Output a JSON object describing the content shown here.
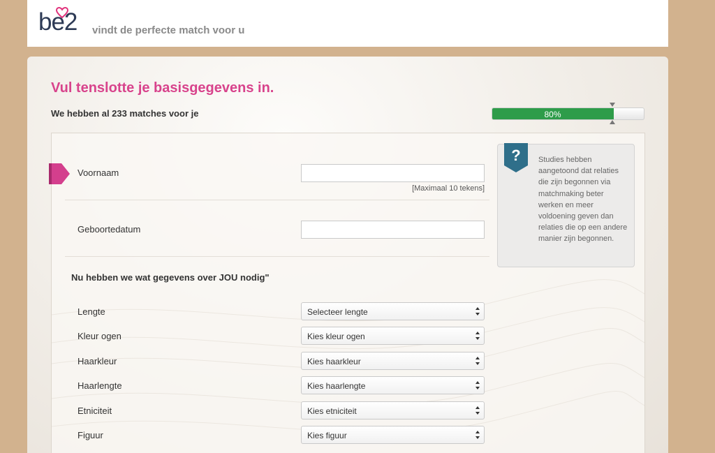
{
  "header": {
    "logo_text": "be2",
    "tagline": "vindt de perfecte match voor u"
  },
  "page": {
    "title": "Vul tenslotte je basisgegevens in.",
    "subtitle": "We hebben al 233 matches voor je"
  },
  "progress": {
    "value": 0.8,
    "label": "80%"
  },
  "form": {
    "first_name": {
      "label": "Voornaam",
      "value": "",
      "hint": "[Maximaal 10 tekens]"
    },
    "birthdate": {
      "label": "Geboortedatum",
      "value": ""
    },
    "section_heading": "Nu hebben we wat gegevens over JOU nodig\"",
    "selects": [
      {
        "label": "Lengte",
        "value": "Selecteer lengte"
      },
      {
        "label": "Kleur ogen",
        "value": "Kies kleur ogen"
      },
      {
        "label": "Haarkleur",
        "value": "Kies haarkleur"
      },
      {
        "label": "Haarlengte",
        "value": "Kies haarlengte"
      },
      {
        "label": "Etniciteit",
        "value": "Kies etniciteit"
      },
      {
        "label": "Figuur",
        "value": "Kies figuur"
      }
    ]
  },
  "info": {
    "icon": "question-mark-icon",
    "text": "Studies hebben aangetoond dat relaties die zijn begonnen via matchmaking beter werken en meer voldoening geven dan relaties die op een andere manier zijn begonnen."
  },
  "colors": {
    "accent": "#d8438c",
    "progress": "#2e9c4a",
    "background": "#d2b28e",
    "badge": "#2f6f8a"
  }
}
